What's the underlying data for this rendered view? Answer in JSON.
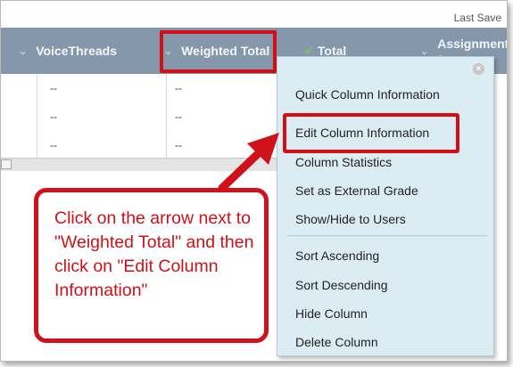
{
  "top": {
    "last_saved": "Last Save"
  },
  "columns": {
    "voicethreads": "VoiceThreads",
    "weighted_total": "Weighted Total",
    "total": "Total",
    "assignment": "Assignment a"
  },
  "rows": [
    {
      "voicethreads": "--",
      "weighted_total": "--"
    },
    {
      "voicethreads": "--",
      "weighted_total": "--"
    },
    {
      "voicethreads": "--",
      "weighted_total": "--"
    }
  ],
  "menu": {
    "items": [
      "Quick Column Information",
      "Edit Column Information",
      "Column Statistics",
      "Set as External Grade",
      "Show/Hide to Users",
      "Sort Ascending",
      "Sort Descending",
      "Hide Column",
      "Delete Column"
    ]
  },
  "callout": {
    "text": "Click on the arrow next to \"Weighted Total\" and then click on \"Edit Column Information\""
  },
  "colors": {
    "header_bg": "#8597aa",
    "menu_bg": "#dbecf2",
    "highlight_red": "#d10f16"
  }
}
